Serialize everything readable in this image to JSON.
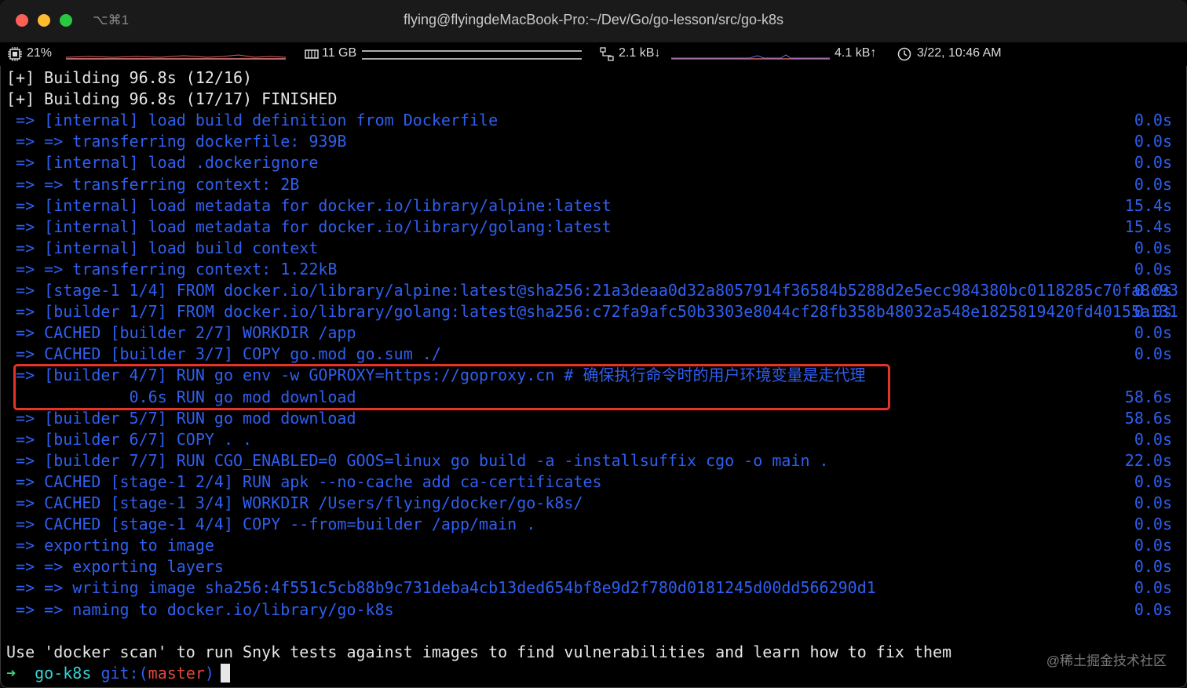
{
  "window": {
    "title": "flying@flyingdeMacBook-Pro:~/Dev/Go/go-lesson/src/go-k8s",
    "shortcut": "⌥⌘1",
    "colors": {
      "close": "#fe5f57",
      "minimize": "#febc2e",
      "zoom": "#28c840"
    }
  },
  "statusbar": {
    "cpu": {
      "icon": "cpu-icon",
      "value": "21%"
    },
    "memory": {
      "icon": "memory-icon",
      "value": "11 GB"
    },
    "network": {
      "icon": "network-icon",
      "down": "2.1 kB↓",
      "up": "4.1 kB↑"
    },
    "clock": {
      "icon": "clock-icon",
      "value": "3/22, 10:46 AM"
    }
  },
  "terminal": {
    "lines": [
      {
        "text": "[+] Building 96.8s (12/16)",
        "duration": "",
        "color": "white"
      },
      {
        "text": "[+] Building 96.8s (17/17) FINISHED",
        "duration": "",
        "color": "white"
      },
      {
        "text": " => [internal] load build definition from Dockerfile",
        "duration": "0.0s",
        "color": "blue"
      },
      {
        "text": " => => transferring dockerfile: 939B",
        "duration": "0.0s",
        "color": "blue"
      },
      {
        "text": " => [internal] load .dockerignore",
        "duration": "0.0s",
        "color": "blue"
      },
      {
        "text": " => => transferring context: 2B",
        "duration": "0.0s",
        "color": "blue"
      },
      {
        "text": " => [internal] load metadata for docker.io/library/alpine:latest",
        "duration": "15.4s",
        "color": "blue"
      },
      {
        "text": " => [internal] load metadata for docker.io/library/golang:latest",
        "duration": "15.4s",
        "color": "blue"
      },
      {
        "text": " => [internal] load build context",
        "duration": "0.0s",
        "color": "blue"
      },
      {
        "text": " => => transferring context: 1.22kB",
        "duration": "0.0s",
        "color": "blue"
      },
      {
        "text": " => [stage-1 1/4] FROM docker.io/library/alpine:latest@sha256:21a3deaa0d32a8057914f36584b5288d2e5ecc984380bc0118285c70fa8c93",
        "duration": "0.0s",
        "color": "blue"
      },
      {
        "text": " => [builder 1/7] FROM docker.io/library/golang:latest@sha256:c72fa9afc50b3303e8044cf28fb358b48032a548e1825819420fd40155a131",
        "duration": "0.0s",
        "color": "blue"
      },
      {
        "text": " => CACHED [builder 2/7] WORKDIR /app",
        "duration": "0.0s",
        "color": "blue"
      },
      {
        "text": " => CACHED [builder 3/7] COPY go.mod go.sum ./",
        "duration": "0.0s",
        "color": "blue"
      },
      {
        "text": " => [builder 4/7] RUN go env -w GOPROXY=https://goproxy.cn # 确保执行命令时的用户环境变量是走代理",
        "duration": "",
        "color": "blue"
      },
      {
        "text": "             0.6s RUN go mod download",
        "duration": "58.6s",
        "color": "blue"
      },
      {
        "text": " => [builder 5/7] RUN go mod download",
        "duration": "58.6s",
        "color": "blue"
      },
      {
        "text": " => [builder 6/7] COPY . .",
        "duration": "0.0s",
        "color": "blue"
      },
      {
        "text": " => [builder 7/7] RUN CGO_ENABLED=0 GOOS=linux go build -a -installsuffix cgo -o main .",
        "duration": "22.0s",
        "color": "blue"
      },
      {
        "text": " => CACHED [stage-1 2/4] RUN apk --no-cache add ca-certificates",
        "duration": "0.0s",
        "color": "blue"
      },
      {
        "text": " => CACHED [stage-1 3/4] WORKDIR /Users/flying/docker/go-k8s/",
        "duration": "0.0s",
        "color": "blue"
      },
      {
        "text": " => CACHED [stage-1 4/4] COPY --from=builder /app/main .",
        "duration": "0.0s",
        "color": "blue"
      },
      {
        "text": " => exporting to image",
        "duration": "0.0s",
        "color": "blue"
      },
      {
        "text": " => => exporting layers",
        "duration": "0.0s",
        "color": "blue"
      },
      {
        "text": " => => writing image sha256:4f551c5cb88b9c731deba4cb13ded654bf8e9d2f780d0181245d00dd566290d1",
        "duration": "0.0s",
        "color": "blue"
      },
      {
        "text": " => => naming to docker.io/library/go-k8s",
        "duration": "0.0s",
        "color": "blue"
      }
    ],
    "hint": "Use 'docker scan' to run Snyk tests against images to find vulnerabilities and learn how to fix them",
    "prompt": {
      "arrow": "➜",
      "dir": "go-k8s",
      "git": "git:(",
      "branch": "master",
      "git_close": ")"
    }
  },
  "watermark": "@稀土掘金技术社区"
}
